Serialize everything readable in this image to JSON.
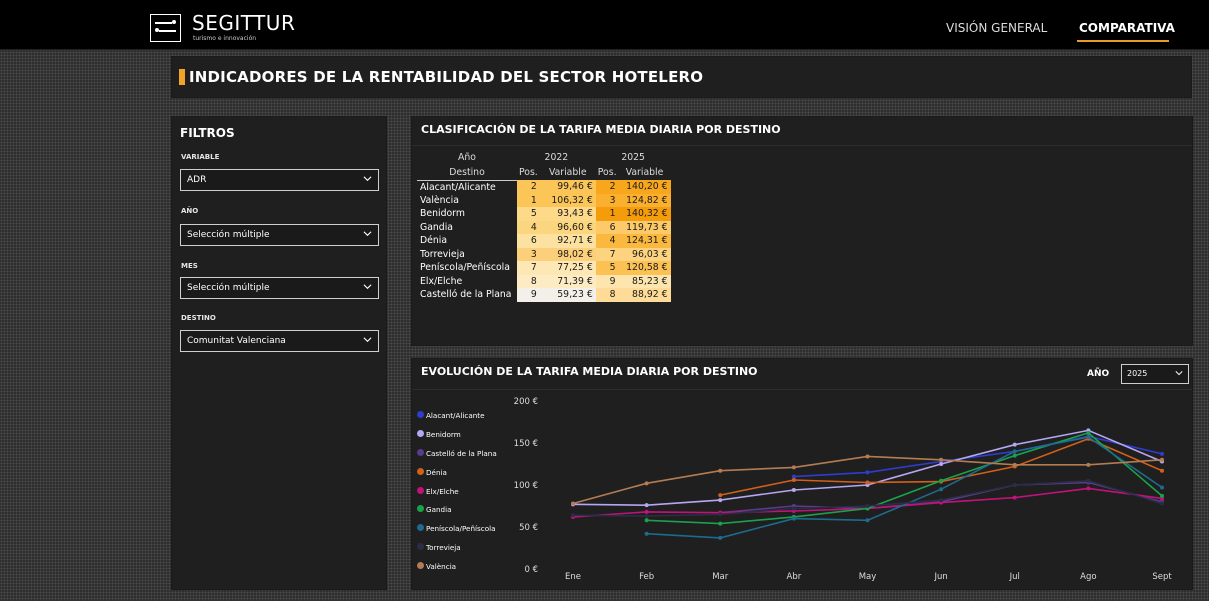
{
  "header": {
    "brand": "SEGITTUR",
    "tagline": "turismo e innovación",
    "nav": [
      "VISIÓN GENERAL",
      "COMPARATIVA"
    ]
  },
  "page_title": "INDICADORES DE LA RENTABILIDAD DEL SECTOR HOTELERO",
  "filters": {
    "title": "FILTROS",
    "variable_label": "VARIABLE",
    "variable_value": "ADR",
    "year_label": "AÑO",
    "year_value": "Selección múltiple",
    "month_label": "MES",
    "month_value": "Selección múltiple",
    "dest_label": "DESTINO",
    "dest_value": "Comunitat Valenciana"
  },
  "ranking": {
    "title": "CLASIFICACIÓN DE LA TARIFA MEDIA DIARIA POR DESTINO",
    "header_year": "Año",
    "header_dest": "Destino",
    "year_a": "2022",
    "year_b": "2025",
    "col_pos": "Pos.",
    "col_var": "Variable",
    "rows": [
      {
        "dest": "Alacant/Alicante",
        "pos22": "2",
        "val22": "99,46 €",
        "pos25": "2",
        "val25": "140,20 €"
      },
      {
        "dest": "València",
        "pos22": "1",
        "val22": "106,32 €",
        "pos25": "3",
        "val25": "124,82 €"
      },
      {
        "dest": "Benidorm",
        "pos22": "5",
        "val22": "93,43 €",
        "pos25": "1",
        "val25": "140,32 €"
      },
      {
        "dest": "Gandia",
        "pos22": "4",
        "val22": "96,60 €",
        "pos25": "6",
        "val25": "119,73 €"
      },
      {
        "dest": "Dénia",
        "pos22": "6",
        "val22": "92,71 €",
        "pos25": "4",
        "val25": "124,31 €"
      },
      {
        "dest": "Torrevieja",
        "pos22": "3",
        "val22": "98,02 €",
        "pos25": "7",
        "val25": "96,03 €"
      },
      {
        "dest": "Peníscola/Peñíscola",
        "pos22": "7",
        "val22": "77,25 €",
        "pos25": "5",
        "val25": "120,58 €"
      },
      {
        "dest": "Elx/Elche",
        "pos22": "8",
        "val22": "71,39 €",
        "pos25": "9",
        "val25": "85,23 €"
      },
      {
        "dest": "Castelló de la Plana",
        "pos22": "9",
        "val22": "59,23 €",
        "pos25": "8",
        "val25": "88,92 €"
      }
    ]
  },
  "evolution": {
    "title": "EVOLUCIÓN DE LA TARIFA MEDIA DIARIA POR DESTINO",
    "year_label": "AÑO",
    "year_value": "2025"
  },
  "chart_data": {
    "type": "line",
    "title": "EVOLUCIÓN DE LA TARIFA MEDIA DIARIA POR DESTINO",
    "x": [
      "Ene",
      "Feb",
      "Mar",
      "Abr",
      "May",
      "Jun",
      "Jul",
      "Ago",
      "Sept"
    ],
    "yticks": [
      "0 €",
      "50 €",
      "100 €",
      "150 €",
      "200 €"
    ],
    "ylim": [
      0,
      200
    ],
    "legend_position": "left",
    "series": [
      {
        "name": "Alacant/Alicante",
        "color": "#2f3ccf",
        "values": [
          null,
          null,
          null,
          110,
          115,
          128,
          140,
          158,
          137
        ]
      },
      {
        "name": "Benidorm",
        "color": "#b5a7f2",
        "values": [
          77,
          76,
          82,
          94,
          100,
          125,
          148,
          165,
          128
        ]
      },
      {
        "name": "Castelló de la Plana",
        "color": "#5b3a8c",
        "values": [
          null,
          null,
          67,
          75,
          72,
          80,
          100,
          103,
          80
        ]
      },
      {
        "name": "Dénia",
        "color": "#d2601a",
        "values": [
          null,
          null,
          88,
          106,
          103,
          104,
          122,
          155,
          117
        ]
      },
      {
        "name": "Elx/Elche",
        "color": "#c2127a",
        "values": [
          62,
          68,
          67,
          69,
          72,
          79,
          85,
          96,
          84
        ]
      },
      {
        "name": "Gandia",
        "color": "#1aa24a",
        "values": [
          null,
          58,
          54,
          62,
          72,
          105,
          135,
          162,
          87
        ]
      },
      {
        "name": "Peníscola/Peñíscola",
        "color": "#1f6a8f",
        "values": [
          null,
          42,
          37,
          60,
          58,
          95,
          140,
          157,
          97
        ]
      },
      {
        "name": "Torrevieja",
        "color": "#2a2d45",
        "values": [
          64,
          63,
          65,
          72,
          75,
          82,
          100,
          105,
          78
        ]
      },
      {
        "name": "València",
        "color": "#b57c52",
        "values": [
          78,
          102,
          117,
          121,
          134,
          130,
          124,
          124,
          130
        ]
      }
    ]
  }
}
